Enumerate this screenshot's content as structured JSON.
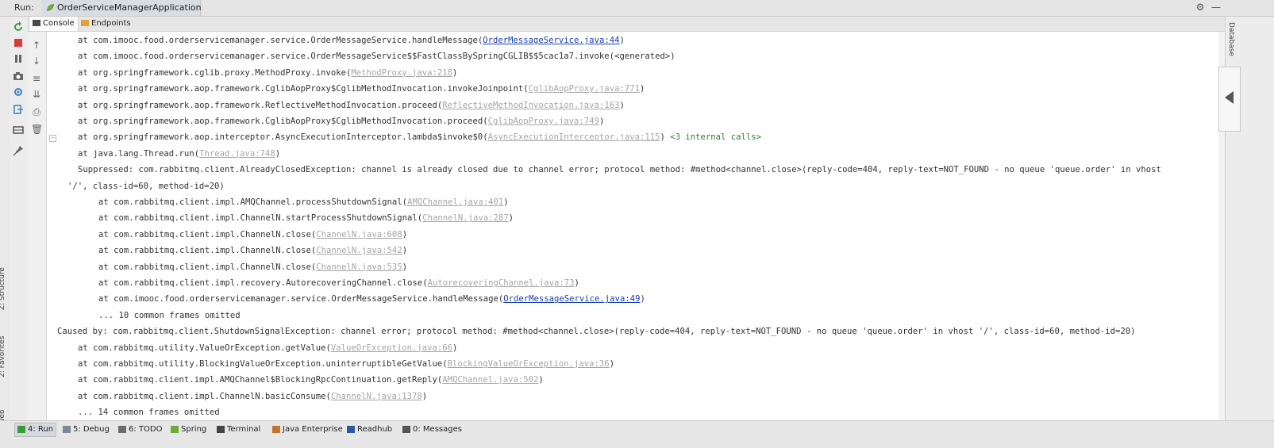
{
  "run_bar": {
    "label": "Run:",
    "config_name": "OrderServiceManagerApplication"
  },
  "sub_tabs": [
    {
      "label": "Console",
      "icon": "console-icon"
    },
    {
      "label": "Endpoints",
      "icon": "endpoints-icon"
    }
  ],
  "left_strip_labels": [
    "Z: Structure",
    "2: Favorites",
    "Web"
  ],
  "right_strip_label": "Database",
  "console": {
    "lines": [
      {
        "indent": 1,
        "text": "at com.imooc.food.orderservicemanager.service.OrderMessageService.handleMessage(",
        "link": "OrderMessageService.java:44",
        "link_style": "blue",
        "suffix": ")"
      },
      {
        "indent": 1,
        "text": "at com.imooc.food.orderservicemanager.service.OrderMessageService$$FastClassBySpringCGLIB$$5cac1a7.invoke(<generated>)",
        "link": "",
        "link_style": "",
        "suffix": ""
      },
      {
        "indent": 1,
        "text": "at org.springframework.cglib.proxy.MethodProxy.invoke(",
        "link": "MethodProxy.java:218",
        "link_style": "gray",
        "suffix": ")"
      },
      {
        "indent": 1,
        "text": "at org.springframework.aop.framework.CglibAopProxy$CglibMethodInvocation.invokeJoinpoint(",
        "link": "CglibAopProxy.java:771",
        "link_style": "gray",
        "suffix": ")"
      },
      {
        "indent": 1,
        "text": "at org.springframework.aop.framework.ReflectiveMethodInvocation.proceed(",
        "link": "ReflectiveMethodInvocation.java:163",
        "link_style": "gray",
        "suffix": ")"
      },
      {
        "indent": 1,
        "text": "at org.springframework.aop.framework.CglibAopProxy$CglibMethodInvocation.proceed(",
        "link": "CglibAopProxy.java:749",
        "link_style": "gray",
        "suffix": ")"
      },
      {
        "indent": 1,
        "text": "at org.springframework.aop.interceptor.AsyncExecutionInterceptor.lambda$invoke$0(",
        "link": "AsyncExecutionInterceptor.java:115",
        "link_style": "gray",
        "suffix": ")",
        "extra": " <3 internal calls>"
      },
      {
        "indent": 1,
        "text": "at java.lang.Thread.run(",
        "link": "Thread.java:748",
        "link_style": "gray",
        "suffix": ")"
      },
      {
        "indent": 1,
        "text": "Suppressed: com.rabbitmq.client.AlreadyClosedException: channel is already closed due to channel error; protocol method: #method<channel.close>(reply-code=404, reply-text=NOT_FOUND - no queue 'queue.order' in vhost",
        "link": "",
        "link_style": "",
        "suffix": ""
      },
      {
        "indent": 0.5,
        "text": "'/', class-id=60, method-id=20)",
        "link": "",
        "link_style": "",
        "suffix": ""
      },
      {
        "indent": 2,
        "text": "at com.rabbitmq.client.impl.AMQChannel.processShutdownSignal(",
        "link": "AMQChannel.java:401",
        "link_style": "gray",
        "suffix": ")"
      },
      {
        "indent": 2,
        "text": "at com.rabbitmq.client.impl.ChannelN.startProcessShutdownSignal(",
        "link": "ChannelN.java:287",
        "link_style": "gray",
        "suffix": ")"
      },
      {
        "indent": 2,
        "text": "at com.rabbitmq.client.impl.ChannelN.close(",
        "link": "ChannelN.java:608",
        "link_style": "gray",
        "suffix": ")"
      },
      {
        "indent": 2,
        "text": "at com.rabbitmq.client.impl.ChannelN.close(",
        "link": "ChannelN.java:542",
        "link_style": "gray",
        "suffix": ")"
      },
      {
        "indent": 2,
        "text": "at com.rabbitmq.client.impl.ChannelN.close(",
        "link": "ChannelN.java:535",
        "link_style": "gray",
        "suffix": ")"
      },
      {
        "indent": 2,
        "text": "at com.rabbitmq.client.impl.recovery.AutorecoveringChannel.close(",
        "link": "AutorecoveringChannel.java:73",
        "link_style": "gray",
        "suffix": ")"
      },
      {
        "indent": 2,
        "text": "at com.imooc.food.orderservicemanager.service.OrderMessageService.handleMessage(",
        "link": "OrderMessageService.java:49",
        "link_style": "blue",
        "suffix": ")"
      },
      {
        "indent": 2,
        "text": "... 10 common frames omitted",
        "link": "",
        "link_style": "",
        "suffix": ""
      },
      {
        "indent": 0,
        "text": "Caused by: com.rabbitmq.client.ShutdownSignalException: channel error; protocol method: #method<channel.close>(reply-code=404, reply-text=NOT_FOUND - no queue 'queue.order' in vhost '/', class-id=60, method-id=20)",
        "link": "",
        "link_style": "",
        "suffix": ""
      },
      {
        "indent": 1,
        "text": "at com.rabbitmq.utility.ValueOrException.getValue(",
        "link": "ValueOrException.java:66",
        "link_style": "gray",
        "suffix": ")"
      },
      {
        "indent": 1,
        "text": "at com.rabbitmq.utility.BlockingValueOrException.uninterruptibleGetValue(",
        "link": "BlockingValueOrException.java:36",
        "link_style": "gray",
        "suffix": ")"
      },
      {
        "indent": 1,
        "text": "at com.rabbitmq.client.impl.AMQChannel$BlockingRpcContinuation.getReply(",
        "link": "AMQChannel.java:502",
        "link_style": "gray",
        "suffix": ")"
      },
      {
        "indent": 1,
        "text": "at com.rabbitmq.client.impl.ChannelN.basicConsume(",
        "link": "ChannelN.java:1378",
        "link_style": "gray",
        "suffix": ")"
      },
      {
        "indent": 1,
        "text": "... 14 common frames omitted",
        "link": "",
        "link_style": "",
        "suffix": ""
      }
    ]
  },
  "bottom_tabs": [
    {
      "label": "4: Run",
      "icon": "run-icon",
      "active": true
    },
    {
      "label": "5: Debug",
      "icon": "debug-icon",
      "active": false
    },
    {
      "label": "6: TODO",
      "icon": "todo-icon",
      "active": false
    },
    {
      "label": "Spring",
      "icon": "spring-icon",
      "active": false
    },
    {
      "label": "Terminal",
      "icon": "terminal-icon",
      "active": false
    },
    {
      "label": "Java Enterprise",
      "icon": "java-enterprise-icon",
      "active": false
    },
    {
      "label": "Readhub",
      "icon": "readhub-icon",
      "active": false
    },
    {
      "label": "0: Messages",
      "icon": "messages-icon",
      "active": false
    }
  ],
  "colors": {
    "link_blue": "#1a3fb0",
    "link_gray": "#a5a5a5",
    "internal_calls": "#2f7d2f"
  }
}
